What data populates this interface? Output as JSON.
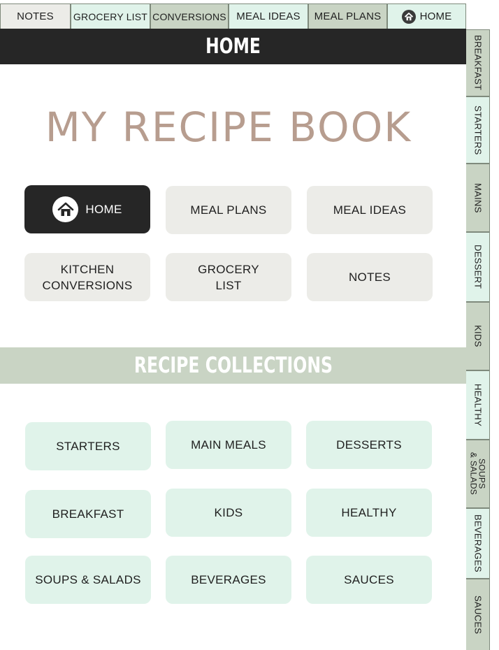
{
  "colors": {
    "sage": "#c9d4c4",
    "mint": "#e0f3ea",
    "dark": "#262626",
    "title_tan": "#b79d8f",
    "light_grey": "#ecece8"
  },
  "top_tabs": [
    {
      "label": "NOTES",
      "bg": "#ecece8"
    },
    {
      "label": "GROCERY LIST",
      "bg": "#e0f3ea"
    },
    {
      "label": "CONVERSIONS",
      "bg": "#c9d4c4"
    },
    {
      "label": "MEAL IDEAS",
      "bg": "#e0f3ea"
    },
    {
      "label": "MEAL PLANS",
      "bg": "#c9d4c4"
    },
    {
      "label": "HOME",
      "bg": "#e0f3ea",
      "icon": "home-icon"
    }
  ],
  "header": {
    "title": "HOME"
  },
  "book_title": "MY RECIPE BOOK",
  "nav": {
    "home": "HOME",
    "meal_plans": "MEAL PLANS",
    "meal_ideas": "MEAL IDEAS",
    "kitchen_conversions_1": "KITCHEN",
    "kitchen_conversions_2": "CONVERSIONS",
    "grocery_list_1": "GROCERY",
    "grocery_list_2": "LIST",
    "notes": "NOTES"
  },
  "section": {
    "title": "RECIPE COLLECTIONS"
  },
  "collections": [
    "STARTERS",
    "MAIN MEALS",
    "DESSERTS",
    "BREAKFAST",
    "KIDS",
    "HEALTHY",
    "SOUPS & SALADS",
    "BEVERAGES",
    "SAUCES"
  ],
  "side_tabs": [
    {
      "label": "BREAKFAST",
      "bg": "#c9d4c4"
    },
    {
      "label": "STARTERS",
      "bg": "#e0f3ea"
    },
    {
      "label": "MAINS",
      "bg": "#c9d4c4"
    },
    {
      "label": "DESSERT",
      "bg": "#e0f3ea"
    },
    {
      "label": "KIDS",
      "bg": "#c9d4c4"
    },
    {
      "label": "HEALTHY",
      "bg": "#e0f3ea"
    },
    {
      "label": "SOUPS",
      "label2": "& SALADS",
      "bg": "#c9d4c4"
    },
    {
      "label": "BEVERAGES",
      "bg": "#e0f3ea"
    },
    {
      "label": "SAUCES",
      "bg": "#c9d4c4"
    }
  ]
}
